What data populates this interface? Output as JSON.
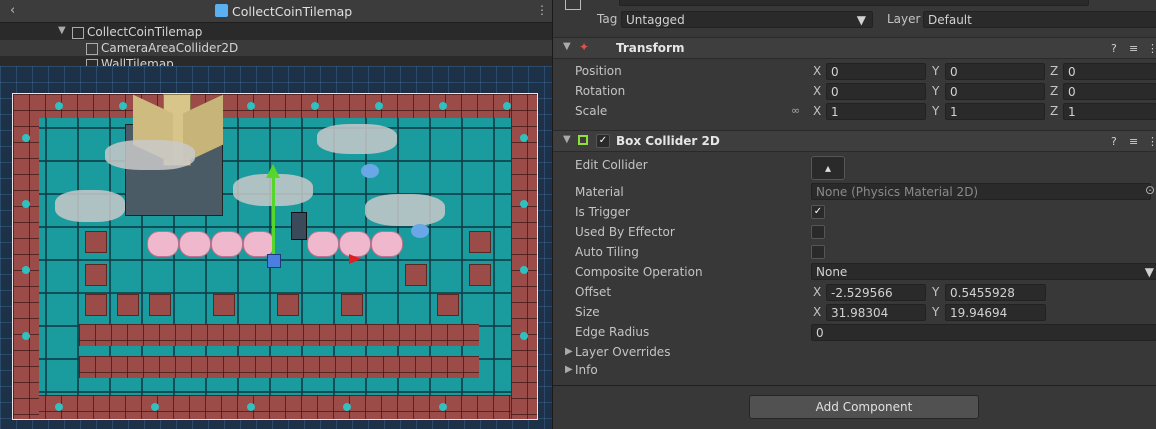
{
  "hierarchy": {
    "title": "CollectCoinTilemap",
    "rows": [
      {
        "label": "CollectCoinTilemap"
      },
      {
        "label": "CameraAreaCollider2D"
      },
      {
        "label": "WallTilemap"
      }
    ]
  },
  "inspector": {
    "tag_label": "Tag",
    "tag_value": "Untagged",
    "layer_label": "Layer",
    "layer_value": "Default",
    "transform": {
      "title": "Transform",
      "position_label": "Position",
      "rotation_label": "Rotation",
      "scale_label": "Scale",
      "position": {
        "x": "0",
        "y": "0",
        "z": "0"
      },
      "rotation": {
        "x": "0",
        "y": "0",
        "z": "0"
      },
      "scale": {
        "x": "1",
        "y": "1",
        "z": "1"
      },
      "axis_x": "X",
      "axis_y": "Y",
      "axis_z": "Z"
    },
    "box_collider": {
      "title": "Box Collider 2D",
      "enabled_check": "✓",
      "edit_collider_label": "Edit Collider",
      "material_label": "Material",
      "material_value": "None (Physics Material 2D)",
      "is_trigger_label": "Is Trigger",
      "is_trigger_check": "✓",
      "used_by_effector_label": "Used By Effector",
      "auto_tiling_label": "Auto Tiling",
      "composite_label": "Composite Operation",
      "composite_value": "None",
      "offset_label": "Offset",
      "offset": {
        "x": "-2.529566",
        "y": "0.5455928"
      },
      "size_label": "Size",
      "size": {
        "x": "31.98304",
        "y": "19.94694"
      },
      "edge_radius_label": "Edge Radius",
      "edge_radius_value": "0",
      "layer_overrides_label": "Layer Overrides",
      "info_label": "Info"
    },
    "add_component_label": "Add Component"
  }
}
